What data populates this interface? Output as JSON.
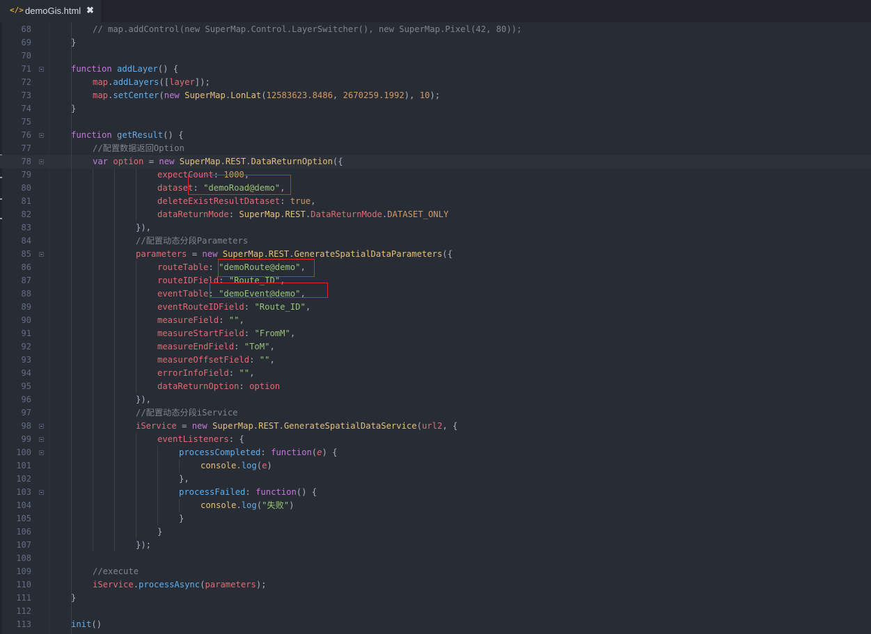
{
  "tab": {
    "title": "demoGis.html",
    "icon": "</>",
    "close": "✖"
  },
  "colors": {
    "background": "#282c34",
    "comment": "#7f848e",
    "keyword": "#c678dd",
    "function": "#61afef",
    "variable": "#e06c75",
    "class": "#e5c07b",
    "string": "#98c379",
    "number": "#d19a66",
    "highlight_box": "#e0242a"
  },
  "editor": {
    "current_line": 78,
    "lines": [
      {
        "n": "68",
        "indent": 2,
        "fold": false,
        "tokens": [
          [
            "cm",
            "// map.addControl(new SuperMap.Control.LayerSwitcher(), new SuperMap.Pixel(42, 80));"
          ]
        ]
      },
      {
        "n": "69",
        "indent": 1,
        "fold": false,
        "tokens": [
          [
            "p",
            "}"
          ]
        ]
      },
      {
        "n": "70",
        "indent": 0,
        "fold": false,
        "tokens": []
      },
      {
        "n": "71",
        "indent": 1,
        "fold": true,
        "tokens": [
          [
            "kw",
            "function"
          ],
          [
            "p",
            " "
          ],
          [
            "fn",
            "addLayer"
          ],
          [
            "p",
            "() {"
          ]
        ]
      },
      {
        "n": "72",
        "indent": 2,
        "fold": false,
        "tokens": [
          [
            "var",
            "map"
          ],
          [
            "p",
            "."
          ],
          [
            "fn",
            "addLayers"
          ],
          [
            "p",
            "(["
          ],
          [
            "var",
            "layer"
          ],
          [
            "p",
            "]);"
          ]
        ]
      },
      {
        "n": "73",
        "indent": 2,
        "fold": false,
        "tokens": [
          [
            "var",
            "map"
          ],
          [
            "p",
            "."
          ],
          [
            "fn",
            "setCenter"
          ],
          [
            "p",
            "("
          ],
          [
            "kw",
            "new"
          ],
          [
            "p",
            " "
          ],
          [
            "cls",
            "SuperMap"
          ],
          [
            "p",
            "."
          ],
          [
            "cls",
            "LonLat"
          ],
          [
            "p",
            "("
          ],
          [
            "num",
            "12583623.8486"
          ],
          [
            "p",
            ", "
          ],
          [
            "num",
            "2670259.1992"
          ],
          [
            "p",
            "), "
          ],
          [
            "num",
            "10"
          ],
          [
            "p",
            ");"
          ]
        ]
      },
      {
        "n": "74",
        "indent": 1,
        "fold": false,
        "tokens": [
          [
            "p",
            "}"
          ]
        ]
      },
      {
        "n": "75",
        "indent": 0,
        "fold": false,
        "tokens": []
      },
      {
        "n": "76",
        "indent": 1,
        "fold": true,
        "tokens": [
          [
            "kw",
            "function"
          ],
          [
            "p",
            " "
          ],
          [
            "fn",
            "getResult"
          ],
          [
            "p",
            "() {"
          ]
        ]
      },
      {
        "n": "77",
        "indent": 2,
        "fold": false,
        "tokens": [
          [
            "cm",
            "//配置数据返回Option"
          ]
        ]
      },
      {
        "n": "78",
        "indent": 2,
        "fold": true,
        "tokens": [
          [
            "kw",
            "var"
          ],
          [
            "p",
            " "
          ],
          [
            "var",
            "option"
          ],
          [
            "p",
            " = "
          ],
          [
            "kw",
            "new"
          ],
          [
            "p",
            " "
          ],
          [
            "cls",
            "SuperMap"
          ],
          [
            "p",
            "."
          ],
          [
            "cls",
            "REST"
          ],
          [
            "p",
            "."
          ],
          [
            "cls",
            "DataReturnOption"
          ],
          [
            "p",
            "({"
          ]
        ]
      },
      {
        "n": "79",
        "indent": 5,
        "fold": false,
        "tokens": [
          [
            "var",
            "expectCount"
          ],
          [
            "p",
            ": "
          ],
          [
            "num",
            "1000"
          ],
          [
            "p",
            ","
          ]
        ]
      },
      {
        "n": "80",
        "indent": 5,
        "fold": false,
        "tokens": [
          [
            "var",
            "dataset"
          ],
          [
            "p",
            ": "
          ],
          [
            "str",
            "\"demoRoad@demo\""
          ],
          [
            "p",
            ","
          ]
        ]
      },
      {
        "n": "81",
        "indent": 5,
        "fold": false,
        "tokens": [
          [
            "var",
            "deleteExistResultDataset"
          ],
          [
            "p",
            ": "
          ],
          [
            "num",
            "true"
          ],
          [
            "p",
            ","
          ]
        ]
      },
      {
        "n": "82",
        "indent": 5,
        "fold": false,
        "tokens": [
          [
            "var",
            "dataReturnMode"
          ],
          [
            "p",
            ": "
          ],
          [
            "cls",
            "SuperMap"
          ],
          [
            "p",
            "."
          ],
          [
            "cls",
            "REST"
          ],
          [
            "p",
            "."
          ],
          [
            "var",
            "DataReturnMode"
          ],
          [
            "p",
            "."
          ],
          [
            "num",
            "DATASET_ONLY"
          ]
        ]
      },
      {
        "n": "83",
        "indent": 4,
        "fold": false,
        "tokens": [
          [
            "p",
            "}),"
          ]
        ]
      },
      {
        "n": "84",
        "indent": 4,
        "fold": false,
        "tokens": [
          [
            "cm",
            "//配置动态分段Parameters"
          ]
        ]
      },
      {
        "n": "85",
        "indent": 4,
        "fold": true,
        "tokens": [
          [
            "var",
            "parameters"
          ],
          [
            "p",
            " = "
          ],
          [
            "kw",
            "new"
          ],
          [
            "p",
            " "
          ],
          [
            "cls",
            "SuperMap"
          ],
          [
            "p",
            "."
          ],
          [
            "cls",
            "REST"
          ],
          [
            "p",
            "."
          ],
          [
            "cls",
            "GenerateSpatialDataParameters"
          ],
          [
            "p",
            "({"
          ]
        ]
      },
      {
        "n": "86",
        "indent": 5,
        "fold": false,
        "tokens": [
          [
            "var",
            "routeTable"
          ],
          [
            "p",
            ": "
          ],
          [
            "str",
            "\"demoRoute@demo\""
          ],
          [
            "p",
            ","
          ]
        ]
      },
      {
        "n": "87",
        "indent": 5,
        "fold": false,
        "tokens": [
          [
            "var",
            "routeIDField"
          ],
          [
            "p",
            ": "
          ],
          [
            "str",
            "\"Route_ID\""
          ],
          [
            "p",
            ","
          ]
        ]
      },
      {
        "n": "88",
        "indent": 5,
        "fold": false,
        "tokens": [
          [
            "var",
            "eventTable"
          ],
          [
            "p",
            ": "
          ],
          [
            "str",
            "\"demoEvent@demo\""
          ],
          [
            "p",
            ","
          ]
        ]
      },
      {
        "n": "89",
        "indent": 5,
        "fold": false,
        "tokens": [
          [
            "var",
            "eventRouteIDField"
          ],
          [
            "p",
            ": "
          ],
          [
            "str",
            "\"Route_ID\""
          ],
          [
            "p",
            ","
          ]
        ]
      },
      {
        "n": "90",
        "indent": 5,
        "fold": false,
        "tokens": [
          [
            "var",
            "measureField"
          ],
          [
            "p",
            ": "
          ],
          [
            "str",
            "\"\""
          ],
          [
            "p",
            ","
          ]
        ]
      },
      {
        "n": "91",
        "indent": 5,
        "fold": false,
        "tokens": [
          [
            "var",
            "measureStartField"
          ],
          [
            "p",
            ": "
          ],
          [
            "str",
            "\"FromM\""
          ],
          [
            "p",
            ","
          ]
        ]
      },
      {
        "n": "92",
        "indent": 5,
        "fold": false,
        "tokens": [
          [
            "var",
            "measureEndField"
          ],
          [
            "p",
            ": "
          ],
          [
            "str",
            "\"ToM\""
          ],
          [
            "p",
            ","
          ]
        ]
      },
      {
        "n": "93",
        "indent": 5,
        "fold": false,
        "tokens": [
          [
            "var",
            "measureOffsetField"
          ],
          [
            "p",
            ": "
          ],
          [
            "str",
            "\"\""
          ],
          [
            "p",
            ","
          ]
        ]
      },
      {
        "n": "94",
        "indent": 5,
        "fold": false,
        "tokens": [
          [
            "var",
            "errorInfoField"
          ],
          [
            "p",
            ": "
          ],
          [
            "str",
            "\"\""
          ],
          [
            "p",
            ","
          ]
        ]
      },
      {
        "n": "95",
        "indent": 5,
        "fold": false,
        "tokens": [
          [
            "var",
            "dataReturnOption"
          ],
          [
            "p",
            ": "
          ],
          [
            "var",
            "option"
          ]
        ]
      },
      {
        "n": "96",
        "indent": 4,
        "fold": false,
        "tokens": [
          [
            "p",
            "}),"
          ]
        ]
      },
      {
        "n": "97",
        "indent": 4,
        "fold": false,
        "tokens": [
          [
            "cm",
            "//配置动态分段iService"
          ]
        ]
      },
      {
        "n": "98",
        "indent": 4,
        "fold": true,
        "tokens": [
          [
            "var",
            "iService"
          ],
          [
            "p",
            " = "
          ],
          [
            "kw",
            "new"
          ],
          [
            "p",
            " "
          ],
          [
            "cls",
            "SuperMap"
          ],
          [
            "p",
            "."
          ],
          [
            "cls",
            "REST"
          ],
          [
            "p",
            "."
          ],
          [
            "cls",
            "GenerateSpatialDataService"
          ],
          [
            "p",
            "("
          ],
          [
            "var",
            "url2"
          ],
          [
            "p",
            ", {"
          ]
        ]
      },
      {
        "n": "99",
        "indent": 5,
        "fold": true,
        "tokens": [
          [
            "var",
            "eventListeners"
          ],
          [
            "p",
            ": {"
          ]
        ]
      },
      {
        "n": "100",
        "indent": 6,
        "fold": true,
        "tokens": [
          [
            "fn",
            "processCompleted"
          ],
          [
            "p",
            ": "
          ],
          [
            "kw",
            "function"
          ],
          [
            "p",
            "("
          ],
          [
            "param",
            "e"
          ],
          [
            "p",
            ") {"
          ]
        ]
      },
      {
        "n": "101",
        "indent": 7,
        "fold": false,
        "tokens": [
          [
            "cls",
            "console"
          ],
          [
            "p",
            "."
          ],
          [
            "fn",
            "log"
          ],
          [
            "p",
            "("
          ],
          [
            "var",
            "e"
          ],
          [
            "p",
            ")"
          ]
        ]
      },
      {
        "n": "102",
        "indent": 6,
        "fold": false,
        "tokens": [
          [
            "p",
            "},"
          ]
        ]
      },
      {
        "n": "103",
        "indent": 6,
        "fold": true,
        "tokens": [
          [
            "fn",
            "processFailed"
          ],
          [
            "p",
            ": "
          ],
          [
            "kw",
            "function"
          ],
          [
            "p",
            "() {"
          ]
        ]
      },
      {
        "n": "104",
        "indent": 7,
        "fold": false,
        "tokens": [
          [
            "cls",
            "console"
          ],
          [
            "p",
            "."
          ],
          [
            "fn",
            "log"
          ],
          [
            "p",
            "("
          ],
          [
            "str",
            "\"失败\""
          ],
          [
            "p",
            ")"
          ]
        ]
      },
      {
        "n": "105",
        "indent": 6,
        "fold": false,
        "tokens": [
          [
            "p",
            "}"
          ]
        ]
      },
      {
        "n": "106",
        "indent": 5,
        "fold": false,
        "tokens": [
          [
            "p",
            "}"
          ]
        ]
      },
      {
        "n": "107",
        "indent": 4,
        "fold": false,
        "tokens": [
          [
            "p",
            "});"
          ]
        ]
      },
      {
        "n": "108",
        "indent": 0,
        "fold": false,
        "tokens": []
      },
      {
        "n": "109",
        "indent": 2,
        "fold": false,
        "tokens": [
          [
            "cm",
            "//execute"
          ]
        ]
      },
      {
        "n": "110",
        "indent": 2,
        "fold": false,
        "tokens": [
          [
            "var",
            "iService"
          ],
          [
            "p",
            "."
          ],
          [
            "fn",
            "processAsync"
          ],
          [
            "p",
            "("
          ],
          [
            "var",
            "parameters"
          ],
          [
            "p",
            ");"
          ]
        ]
      },
      {
        "n": "111",
        "indent": 1,
        "fold": false,
        "tokens": [
          [
            "p",
            "}"
          ]
        ]
      },
      {
        "n": "112",
        "indent": 0,
        "fold": false,
        "tokens": []
      },
      {
        "n": "113",
        "indent": 1,
        "fold": false,
        "tokens": [
          [
            "fn",
            "init"
          ],
          [
            "p",
            "()"
          ]
        ]
      }
    ]
  }
}
